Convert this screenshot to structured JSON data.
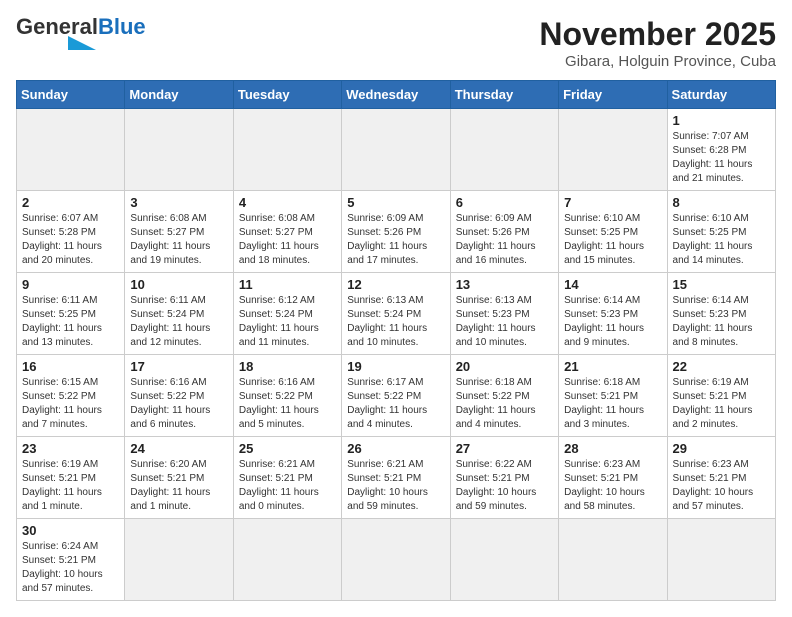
{
  "header": {
    "logo_general": "General",
    "logo_blue": "Blue",
    "month_title": "November 2025",
    "subtitle": "Gibara, Holguin Province, Cuba"
  },
  "days_of_week": [
    "Sunday",
    "Monday",
    "Tuesday",
    "Wednesday",
    "Thursday",
    "Friday",
    "Saturday"
  ],
  "weeks": [
    [
      {
        "day": "",
        "sunrise": "",
        "sunset": "",
        "daylight": ""
      },
      {
        "day": "",
        "sunrise": "",
        "sunset": "",
        "daylight": ""
      },
      {
        "day": "",
        "sunrise": "",
        "sunset": "",
        "daylight": ""
      },
      {
        "day": "",
        "sunrise": "",
        "sunset": "",
        "daylight": ""
      },
      {
        "day": "",
        "sunrise": "",
        "sunset": "",
        "daylight": ""
      },
      {
        "day": "",
        "sunrise": "",
        "sunset": "",
        "daylight": ""
      },
      {
        "day": "1",
        "sunrise": "Sunrise: 7:07 AM",
        "sunset": "Sunset: 6:28 PM",
        "daylight": "Daylight: 11 hours and 21 minutes."
      }
    ],
    [
      {
        "day": "2",
        "sunrise": "Sunrise: 6:07 AM",
        "sunset": "Sunset: 5:28 PM",
        "daylight": "Daylight: 11 hours and 20 minutes."
      },
      {
        "day": "3",
        "sunrise": "Sunrise: 6:08 AM",
        "sunset": "Sunset: 5:27 PM",
        "daylight": "Daylight: 11 hours and 19 minutes."
      },
      {
        "day": "4",
        "sunrise": "Sunrise: 6:08 AM",
        "sunset": "Sunset: 5:27 PM",
        "daylight": "Daylight: 11 hours and 18 minutes."
      },
      {
        "day": "5",
        "sunrise": "Sunrise: 6:09 AM",
        "sunset": "Sunset: 5:26 PM",
        "daylight": "Daylight: 11 hours and 17 minutes."
      },
      {
        "day": "6",
        "sunrise": "Sunrise: 6:09 AM",
        "sunset": "Sunset: 5:26 PM",
        "daylight": "Daylight: 11 hours and 16 minutes."
      },
      {
        "day": "7",
        "sunrise": "Sunrise: 6:10 AM",
        "sunset": "Sunset: 5:25 PM",
        "daylight": "Daylight: 11 hours and 15 minutes."
      },
      {
        "day": "8",
        "sunrise": "Sunrise: 6:10 AM",
        "sunset": "Sunset: 5:25 PM",
        "daylight": "Daylight: 11 hours and 14 minutes."
      }
    ],
    [
      {
        "day": "9",
        "sunrise": "Sunrise: 6:11 AM",
        "sunset": "Sunset: 5:25 PM",
        "daylight": "Daylight: 11 hours and 13 minutes."
      },
      {
        "day": "10",
        "sunrise": "Sunrise: 6:11 AM",
        "sunset": "Sunset: 5:24 PM",
        "daylight": "Daylight: 11 hours and 12 minutes."
      },
      {
        "day": "11",
        "sunrise": "Sunrise: 6:12 AM",
        "sunset": "Sunset: 5:24 PM",
        "daylight": "Daylight: 11 hours and 11 minutes."
      },
      {
        "day": "12",
        "sunrise": "Sunrise: 6:13 AM",
        "sunset": "Sunset: 5:24 PM",
        "daylight": "Daylight: 11 hours and 10 minutes."
      },
      {
        "day": "13",
        "sunrise": "Sunrise: 6:13 AM",
        "sunset": "Sunset: 5:23 PM",
        "daylight": "Daylight: 11 hours and 10 minutes."
      },
      {
        "day": "14",
        "sunrise": "Sunrise: 6:14 AM",
        "sunset": "Sunset: 5:23 PM",
        "daylight": "Daylight: 11 hours and 9 minutes."
      },
      {
        "day": "15",
        "sunrise": "Sunrise: 6:14 AM",
        "sunset": "Sunset: 5:23 PM",
        "daylight": "Daylight: 11 hours and 8 minutes."
      }
    ],
    [
      {
        "day": "16",
        "sunrise": "Sunrise: 6:15 AM",
        "sunset": "Sunset: 5:22 PM",
        "daylight": "Daylight: 11 hours and 7 minutes."
      },
      {
        "day": "17",
        "sunrise": "Sunrise: 6:16 AM",
        "sunset": "Sunset: 5:22 PM",
        "daylight": "Daylight: 11 hours and 6 minutes."
      },
      {
        "day": "18",
        "sunrise": "Sunrise: 6:16 AM",
        "sunset": "Sunset: 5:22 PM",
        "daylight": "Daylight: 11 hours and 5 minutes."
      },
      {
        "day": "19",
        "sunrise": "Sunrise: 6:17 AM",
        "sunset": "Sunset: 5:22 PM",
        "daylight": "Daylight: 11 hours and 4 minutes."
      },
      {
        "day": "20",
        "sunrise": "Sunrise: 6:18 AM",
        "sunset": "Sunset: 5:22 PM",
        "daylight": "Daylight: 11 hours and 4 minutes."
      },
      {
        "day": "21",
        "sunrise": "Sunrise: 6:18 AM",
        "sunset": "Sunset: 5:21 PM",
        "daylight": "Daylight: 11 hours and 3 minutes."
      },
      {
        "day": "22",
        "sunrise": "Sunrise: 6:19 AM",
        "sunset": "Sunset: 5:21 PM",
        "daylight": "Daylight: 11 hours and 2 minutes."
      }
    ],
    [
      {
        "day": "23",
        "sunrise": "Sunrise: 6:19 AM",
        "sunset": "Sunset: 5:21 PM",
        "daylight": "Daylight: 11 hours and 1 minute."
      },
      {
        "day": "24",
        "sunrise": "Sunrise: 6:20 AM",
        "sunset": "Sunset: 5:21 PM",
        "daylight": "Daylight: 11 hours and 1 minute."
      },
      {
        "day": "25",
        "sunrise": "Sunrise: 6:21 AM",
        "sunset": "Sunset: 5:21 PM",
        "daylight": "Daylight: 11 hours and 0 minutes."
      },
      {
        "day": "26",
        "sunrise": "Sunrise: 6:21 AM",
        "sunset": "Sunset: 5:21 PM",
        "daylight": "Daylight: 10 hours and 59 minutes."
      },
      {
        "day": "27",
        "sunrise": "Sunrise: 6:22 AM",
        "sunset": "Sunset: 5:21 PM",
        "daylight": "Daylight: 10 hours and 59 minutes."
      },
      {
        "day": "28",
        "sunrise": "Sunrise: 6:23 AM",
        "sunset": "Sunset: 5:21 PM",
        "daylight": "Daylight: 10 hours and 58 minutes."
      },
      {
        "day": "29",
        "sunrise": "Sunrise: 6:23 AM",
        "sunset": "Sunset: 5:21 PM",
        "daylight": "Daylight: 10 hours and 57 minutes."
      }
    ],
    [
      {
        "day": "30",
        "sunrise": "Sunrise: 6:24 AM",
        "sunset": "Sunset: 5:21 PM",
        "daylight": "Daylight: 10 hours and 57 minutes."
      },
      {
        "day": "",
        "sunrise": "",
        "sunset": "",
        "daylight": ""
      },
      {
        "day": "",
        "sunrise": "",
        "sunset": "",
        "daylight": ""
      },
      {
        "day": "",
        "sunrise": "",
        "sunset": "",
        "daylight": ""
      },
      {
        "day": "",
        "sunrise": "",
        "sunset": "",
        "daylight": ""
      },
      {
        "day": "",
        "sunrise": "",
        "sunset": "",
        "daylight": ""
      },
      {
        "day": "",
        "sunrise": "",
        "sunset": "",
        "daylight": ""
      }
    ]
  ]
}
